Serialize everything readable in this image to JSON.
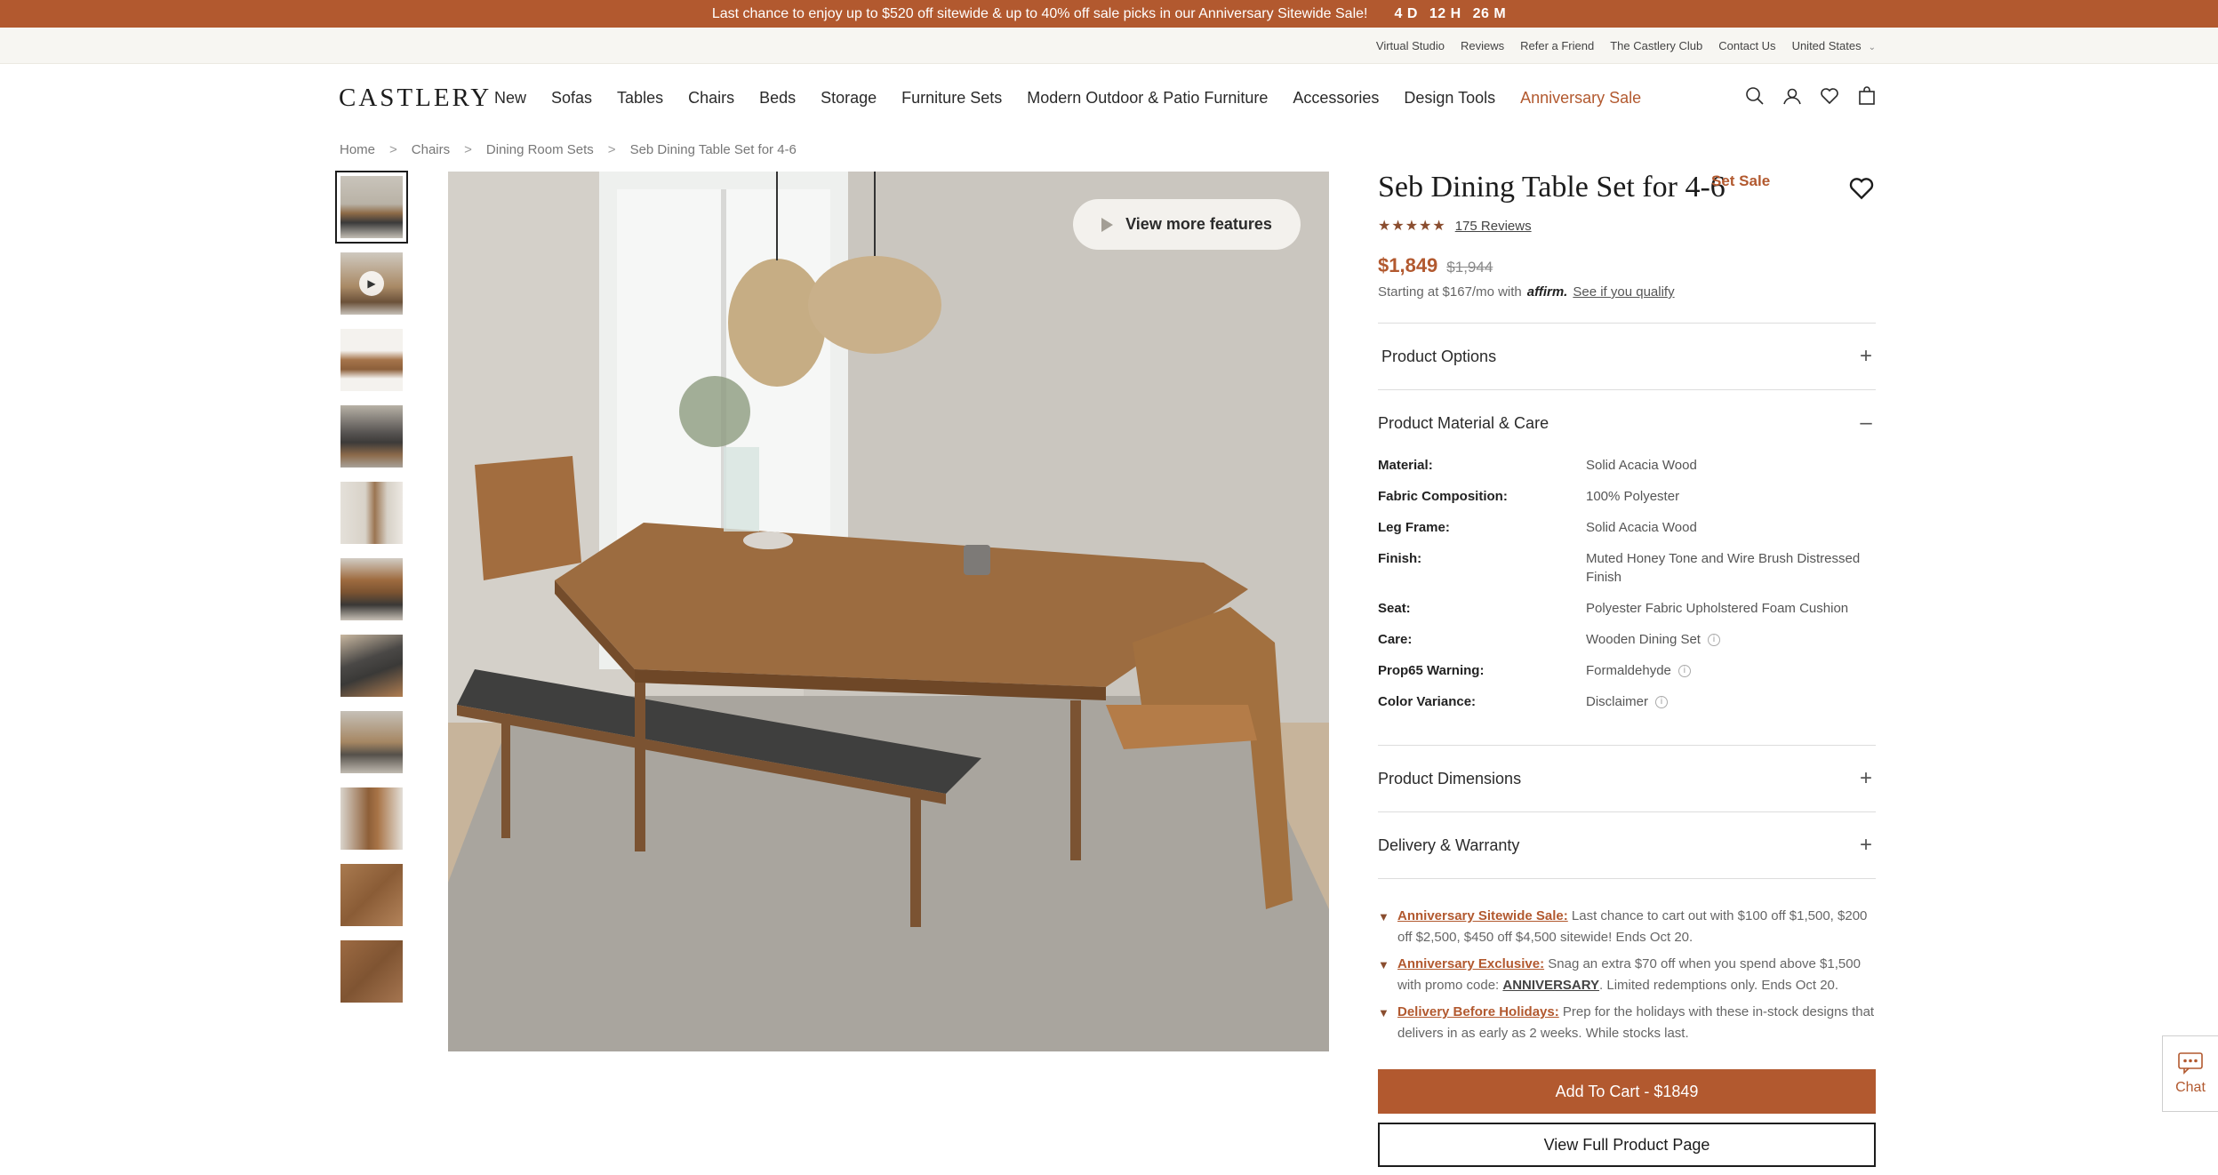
{
  "announcement": {
    "text": "Last chance to enjoy up to $520 off sitewide & up to 40% off sale picks in our Anniversary Sitewide Sale!",
    "countdown_days": "4 D",
    "countdown_hours": "12 H",
    "countdown_minutes": "26 M"
  },
  "utility_links": [
    "Virtual Studio",
    "Reviews",
    "Refer a Friend",
    "The Castlery Club",
    "Contact Us",
    "United States"
  ],
  "header": {
    "logo": "CASTLERY",
    "nav": [
      "New",
      "Sofas",
      "Tables",
      "Chairs",
      "Beds",
      "Storage",
      "Furniture Sets",
      "Modern Outdoor & Patio Furniture",
      "Accessories",
      "Design Tools"
    ],
    "nav_sale": "Anniversary Sale",
    "icons": [
      "search-icon",
      "account-icon",
      "wishlist-icon",
      "cart-icon"
    ]
  },
  "breadcrumb": [
    "Home",
    "Chairs",
    "Dining Room Sets",
    "Seb Dining Table Set for 4-6"
  ],
  "gallery": {
    "thumbnail_count": 11,
    "feature_button": "View more features"
  },
  "product": {
    "title": "Seb Dining Table Set for 4-6",
    "sale_tag": "Set Sale",
    "rating": 5,
    "reviews": "175 Reviews",
    "price": "$1,849",
    "original_price": "$1,944",
    "finance_text": "Starting at $167/mo with",
    "finance_brand": "affirm.",
    "finance_link": "See if you qualify"
  },
  "accordions": {
    "options": "Product Options",
    "material": "Product Material & Care",
    "dimensions": "Product Dimensions",
    "delivery": "Delivery & Warranty"
  },
  "specs": [
    {
      "key": "Material:",
      "value": "Solid Acacia Wood"
    },
    {
      "key": "Fabric Composition:",
      "value": "100% Polyester"
    },
    {
      "key": "Leg Frame:",
      "value": "Solid Acacia Wood"
    },
    {
      "key": "Finish:",
      "value": "Muted Honey Tone and Wire Brush Distressed Finish"
    },
    {
      "key": "Seat:",
      "value": "Polyester Fabric Upholstered Foam Cushion"
    },
    {
      "key": "Care:",
      "value": "Wooden Dining Set"
    },
    {
      "key": "Prop65 Warning:",
      "value": "Formaldehyde"
    },
    {
      "key": "Color Variance:",
      "value": "Disclaimer"
    }
  ],
  "promos": [
    {
      "label": "Anniversary Sitewide Sale:",
      "text": " Last chance to cart out with $100 off $1,500, $200 off $2,500, $450 off $4,500 sitewide! Ends Oct 20."
    },
    {
      "label": "Anniversary Exclusive:",
      "text_before": " Snag an extra $70 off when you spend above $1,500 with promo code: ",
      "code": "ANNIVERSARY",
      "text_after": ". Limited redemptions only. Ends Oct 20."
    },
    {
      "label": "Delivery Before Holidays:",
      "text": " Prep for the holidays with these in-stock designs that delivers in as early as 2 weeks. While stocks last."
    }
  ],
  "buttons": {
    "add_to_cart": "Add To Cart - $1849",
    "view_full": "View Full Product Page"
  },
  "chat": {
    "label": "Chat"
  },
  "colors": {
    "brand": "#b2592f",
    "announcement_bg": "#b2592f",
    "stars": "#8a4d2f"
  }
}
